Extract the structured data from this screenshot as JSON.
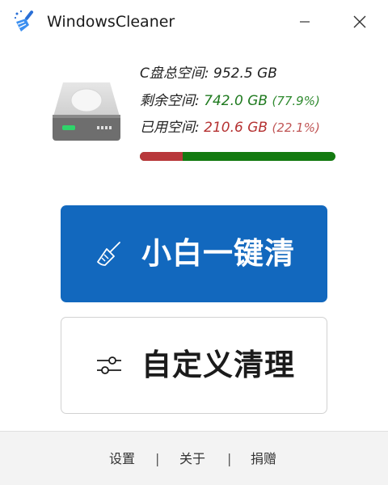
{
  "app": {
    "title": "WindowsCleaner"
  },
  "window_controls": {
    "minimize_icon": "minimize-icon",
    "close_icon": "close-icon"
  },
  "disk": {
    "total_label": "C盘总空间: ",
    "total_value": "952.5 GB",
    "free_label": "剩余空间: ",
    "free_value": "742.0 GB",
    "free_percent": "(77.9%)",
    "used_label": "已用空间: ",
    "used_value": "210.6 GB",
    "used_percent": "(22.1%)",
    "used_fraction": 0.221
  },
  "buttons": {
    "one_click": {
      "label": "小白一键清",
      "icon": "broom-icon"
    },
    "custom": {
      "label": "自定义清理",
      "icon": "sliders-icon"
    }
  },
  "footer": {
    "settings": "设置",
    "separator": "|",
    "about": "关于",
    "donate": "捐赠"
  },
  "colors": {
    "primary": "#1268be",
    "free": "#1f7a1f",
    "used": "#b53232",
    "bar_free": "#137a10",
    "bar_used": "#b8383b"
  }
}
